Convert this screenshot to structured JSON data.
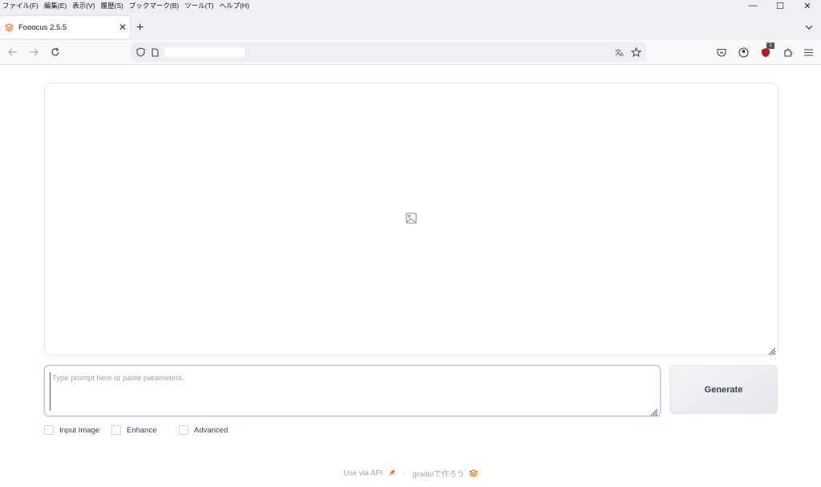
{
  "menubar": {
    "items": [
      "ファイル(F)",
      "編集(E)",
      "表示(V)",
      "履歴(S)",
      "ブックマーク(B)",
      "ツール(T)",
      "ヘルプ(H)"
    ]
  },
  "window_controls": {
    "minimize": "—",
    "maximize": "☐",
    "close": "✕"
  },
  "tab": {
    "title": "Fooocus 2.5.5",
    "close": "✕"
  },
  "newtab_label": "+",
  "extensions": {
    "badge_count": "1"
  },
  "prompt": {
    "placeholder": "Type prompt here or paste parameters.",
    "value": ""
  },
  "generate": {
    "label": "Generate"
  },
  "options": [
    {
      "label": "Input Image",
      "checked": false
    },
    {
      "label": "Enhance",
      "checked": false
    },
    {
      "label": "Advanced",
      "checked": false
    }
  ],
  "footer": {
    "api_label": "Use via API",
    "separator": "·",
    "made_with": "gradioで作ろう"
  },
  "colors": {
    "accent_orange": "#f97316",
    "focus_blue": "#a8c6f2",
    "chrome_bg": "#f0f0f4"
  }
}
